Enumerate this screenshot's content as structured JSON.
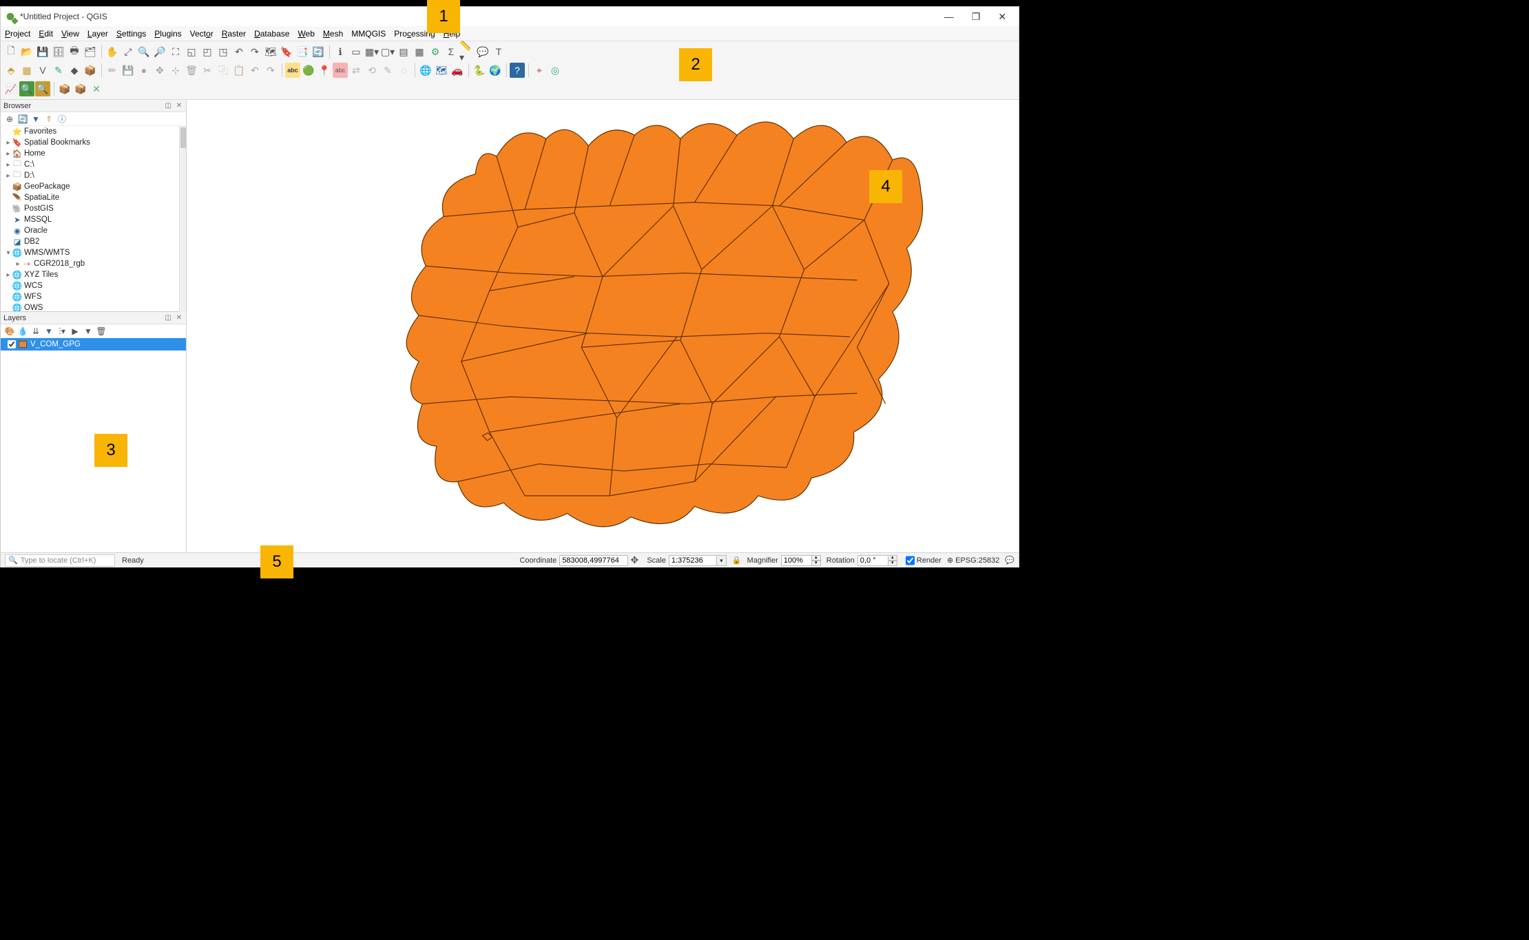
{
  "window": {
    "title": "*Untitled Project - QGIS"
  },
  "menubar": [
    "Project",
    "Edit",
    "View",
    "Layer",
    "Settings",
    "Plugins",
    "Vector",
    "Raster",
    "Database",
    "Web",
    "Mesh",
    "MMQGIS",
    "Processing",
    "Help"
  ],
  "browser": {
    "title": "Browser",
    "items": [
      {
        "exp": "",
        "icon": "⭐",
        "label": "Favorites",
        "indent": 0,
        "color": "#f5c518"
      },
      {
        "exp": "▸",
        "icon": "🔖",
        "label": "Spatial Bookmarks",
        "indent": 0
      },
      {
        "exp": "▸",
        "icon": "🏠",
        "label": "Home",
        "indent": 0
      },
      {
        "exp": "▸",
        "icon": "🗀",
        "label": "C:\\",
        "indent": 0
      },
      {
        "exp": "▸",
        "icon": "🗀",
        "label": "D:\\",
        "indent": 0
      },
      {
        "exp": "",
        "icon": "📦",
        "label": "GeoPackage",
        "indent": 0,
        "color": "#c79b2e"
      },
      {
        "exp": "",
        "icon": "🪶",
        "label": "SpatiaLite",
        "indent": 0,
        "color": "#3b6fa3"
      },
      {
        "exp": "",
        "icon": "🐘",
        "label": "PostGIS",
        "indent": 0,
        "color": "#2b6aa0"
      },
      {
        "exp": "",
        "icon": "➤",
        "label": "MSSQL",
        "indent": 0,
        "color": "#2b6aa0"
      },
      {
        "exp": "",
        "icon": "◉",
        "label": "Oracle",
        "indent": 0,
        "color": "#2b6aa0"
      },
      {
        "exp": "",
        "icon": "◪",
        "label": "DB2",
        "indent": 0,
        "color": "#2b6aa0"
      },
      {
        "exp": "▾",
        "icon": "🌐",
        "label": "WMS/WMTS",
        "indent": 0,
        "color": "#2b6aa0"
      },
      {
        "exp": "▸",
        "icon": "⇢",
        "label": "CGR2018_rgb",
        "indent": 1,
        "color": "#c0722e"
      },
      {
        "exp": "▸",
        "icon": "🌐",
        "label": "XYZ Tiles",
        "indent": 0,
        "color": "#2b6aa0"
      },
      {
        "exp": "",
        "icon": "🌐",
        "label": "WCS",
        "indent": 0,
        "color": "#2b6aa0"
      },
      {
        "exp": "",
        "icon": "🌐",
        "label": "WFS",
        "indent": 0,
        "color": "#2b6aa0"
      },
      {
        "exp": "",
        "icon": "🌐",
        "label": "OWS",
        "indent": 0,
        "color": "#2b6aa0"
      }
    ]
  },
  "layers": {
    "title": "Layers",
    "active": {
      "checked": true,
      "name": "V_COM_GPG"
    }
  },
  "statusbar": {
    "locator_placeholder": "Type to locate (Ctrl+K)",
    "ready": "Ready",
    "coord_label": "Coordinate",
    "coord_value": "583008,4997764",
    "scale_label": "Scale",
    "scale_value": "1:375236",
    "magnifier_label": "Magnifier",
    "magnifier_value": "100%",
    "rotation_label": "Rotation",
    "rotation_value": "0,0 °",
    "render_label": "Render",
    "epsg": "EPSG:25832"
  },
  "callouts": {
    "c1": "1",
    "c2": "2",
    "c3": "3",
    "c4": "4",
    "c5": "5"
  }
}
